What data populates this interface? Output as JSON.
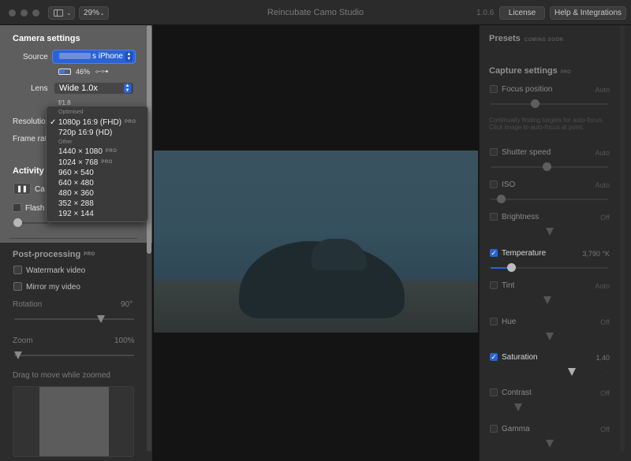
{
  "window": {
    "title": "Reincubate Camo Studio",
    "version": "1.0.6",
    "zoom": "29%",
    "license_label": "License",
    "help_label": "Help & Integrations"
  },
  "camera": {
    "header": "Camera settings",
    "source_label": "Source",
    "source_value": "s iPhone",
    "battery": "46%",
    "lens_label": "Lens",
    "lens_value": "Wide 1.0x",
    "aperture": "f/1.8",
    "resolution_label": "Resolutio",
    "framerate_label": "Frame rat"
  },
  "resolution_menu": {
    "section_optimised": "Optimised",
    "section_other": "Other",
    "pro_tag": "PRO",
    "optimised": [
      {
        "label": "1080p 16:9 (FHD)",
        "pro": true,
        "selected": true
      },
      {
        "label": "720p 16:9 (HD)",
        "pro": false,
        "selected": false
      }
    ],
    "other": [
      {
        "label": "1440 × 1080",
        "pro": true
      },
      {
        "label": "1024 × 768",
        "pro": true
      },
      {
        "label": "960 × 540",
        "pro": false
      },
      {
        "label": "640 × 480",
        "pro": false
      },
      {
        "label": "480 × 360",
        "pro": false
      },
      {
        "label": "352 × 288",
        "pro": false
      },
      {
        "label": "192 × 144",
        "pro": false
      }
    ]
  },
  "activity": {
    "header": "Activity o",
    "camera_label": "Ca",
    "flash_label": "Flash"
  },
  "postprocessing": {
    "header": "Post-processing",
    "pro_tag": "PRO",
    "watermark_label": "Watermark video",
    "mirror_label": "Mirror my video",
    "rotation_label": "Rotation",
    "rotation_value": "90°",
    "zoom_label": "Zoom",
    "zoom_value": "100%",
    "drag_hint": "Drag to move while zoomed"
  },
  "presets": {
    "header": "Presets",
    "badge": "COMING SOON"
  },
  "capture": {
    "header": "Capture settings",
    "pro_tag": "PRO",
    "focus_note": "Continually finding targets for auto-focus. Click image to auto-focus at point.",
    "settings": [
      {
        "label": "Focus position",
        "value": "Auto",
        "checked": false
      },
      {
        "label": "Shutter speed",
        "value": "Auto",
        "checked": false
      },
      {
        "label": "ISO",
        "value": "Auto",
        "checked": false
      },
      {
        "label": "Brightness",
        "value": "Off",
        "checked": false
      },
      {
        "label": "Temperature",
        "value": "3,790 °K",
        "checked": true
      },
      {
        "label": "Tint",
        "value": "Auto",
        "checked": false
      },
      {
        "label": "Hue",
        "value": "Off",
        "checked": false
      },
      {
        "label": "Saturation",
        "value": "1.40",
        "checked": true
      },
      {
        "label": "Contrast",
        "value": "Off",
        "checked": false
      },
      {
        "label": "Gamma",
        "value": "Off",
        "checked": false
      }
    ]
  },
  "icons": {
    "sidebar": "sidebar-toggle-icon",
    "battery": "battery-icon",
    "usb": "usb-icon",
    "pause": "pause-icon",
    "check": "checkmark-icon"
  },
  "colors": {
    "accent": "#2a63d4",
    "panel": "#2c2c2c",
    "background": "#1e1e1e"
  }
}
